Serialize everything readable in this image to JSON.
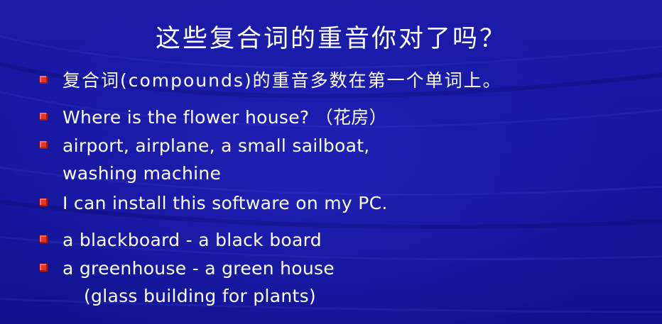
{
  "slide": {
    "title": "这些复合词的重音你对了吗？",
    "lines": [
      "复合词(compounds)的重音多数在第一个单词上。",
      "Where is the flower house?  （花房）",
      "airport, airplane, a small sailboat,",
      "washing machine",
      "I can install this software on my PC.",
      "a blackboard - a black board",
      "a greenhouse - a green house",
      "(glass building for plants)"
    ]
  },
  "colors": {
    "background": "#1a1aa0",
    "text": "#ffffff",
    "bullet": "#e2362b"
  }
}
